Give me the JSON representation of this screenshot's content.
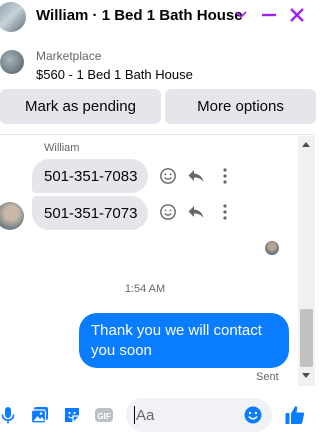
{
  "header": {
    "title": "William · 1 Bed 1 Bath House"
  },
  "marketplace": {
    "label": "Marketplace",
    "listing": "$560 - 1 Bed 1 Bath House"
  },
  "actions": {
    "pending_label": "Mark as pending",
    "more_label": "More options"
  },
  "conversation": {
    "sender_name": "William",
    "incoming": [
      {
        "text": "501-351-7083"
      },
      {
        "text": "501-351-7073"
      }
    ],
    "timestamp": "1:54 AM",
    "outgoing": {
      "text": "Thank you we will contact you soon",
      "status": "Sent"
    }
  },
  "composer": {
    "placeholder": "Aa",
    "icons": [
      "microphone-icon",
      "photo-icon",
      "sticker-icon",
      "gif-icon",
      "emoji-icon",
      "thumbs-up-icon"
    ]
  },
  "colors": {
    "accent": "#0a7cff",
    "header_controls": "#a020f0",
    "bubble_in": "#e4e6eb"
  }
}
